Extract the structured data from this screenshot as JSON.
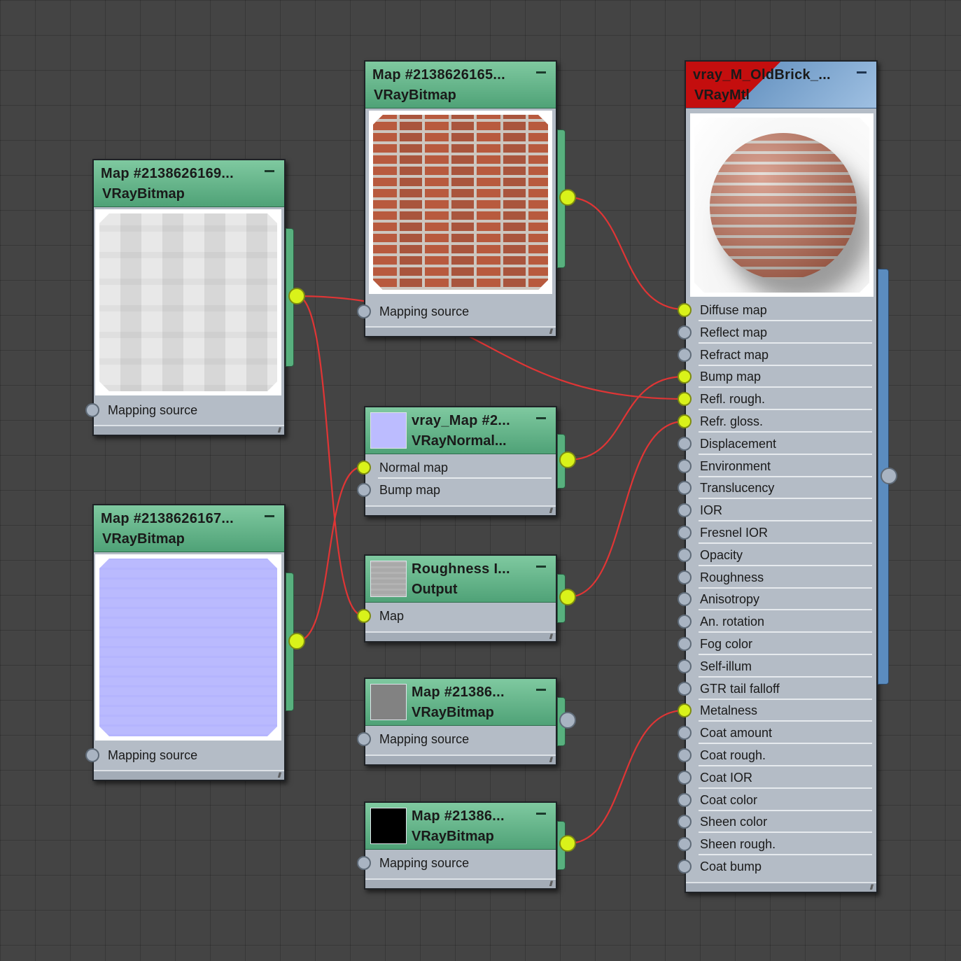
{
  "nodes": {
    "bitmap_gray_top": {
      "title": "Map #2138626169...",
      "subtitle": "VRayBitmap",
      "inputs": [
        "Mapping source"
      ]
    },
    "bitmap_brick": {
      "title": "Map #2138626165...",
      "subtitle": "VRayBitmap",
      "inputs": [
        "Mapping source"
      ]
    },
    "bitmap_normal": {
      "title": "Map #2138626167...",
      "subtitle": "VRayBitmap",
      "inputs": [
        "Mapping source"
      ]
    },
    "vray_normal_map": {
      "title": "vray_Map #2...",
      "subtitle": "VRayNormal...",
      "inputs": [
        "Normal map",
        "Bump map"
      ]
    },
    "roughness_output": {
      "title": "Roughness I...",
      "subtitle": "Output",
      "inputs": [
        "Map"
      ]
    },
    "bitmap_gray_small": {
      "title": "Map #21386...",
      "subtitle": "VRayBitmap",
      "inputs": [
        "Mapping source"
      ]
    },
    "bitmap_black_small": {
      "title": "Map #21386...",
      "subtitle": "VRayBitmap",
      "inputs": [
        "Mapping source"
      ]
    },
    "vray_mtl": {
      "title": "vray_M_OldBrick_...",
      "subtitle": "VRayMtl",
      "inputs": [
        "Diffuse map",
        "Reflect map",
        "Refract map",
        "Bump map",
        "Refl. rough.",
        "Refr. gloss.",
        "Displacement",
        "Environment",
        "Translucency",
        "IOR",
        "Fresnel IOR",
        "Opacity",
        "Roughness",
        "Anisotropy",
        "An. rotation",
        "Fog color",
        "Self-illum",
        "GTR tail falloff",
        "Metalness",
        "Coat amount",
        "Coat rough.",
        "Coat IOR",
        "Coat color",
        "Sheen color",
        "Sheen rough.",
        "Coat bump"
      ],
      "connected_inputs": [
        "Diffuse map",
        "Bump map",
        "Refl. rough.",
        "Refr. gloss.",
        "Metalness"
      ]
    }
  },
  "colors": {
    "background": "#444444",
    "node_body": "#b4bcc6",
    "node_header": "#5aae80",
    "material_header_red": "#c40e0e",
    "material_header_blue": "#8fb4dc",
    "wire": "#e03535",
    "active_socket": "#d9f21a",
    "inactive_socket": "#a9b4c2",
    "normal_map_swatch": "#bcbcff"
  },
  "icons": {
    "collapse": "minus-icon",
    "resize": "resize-grip-icon",
    "socket": "socket-circle-icon"
  }
}
